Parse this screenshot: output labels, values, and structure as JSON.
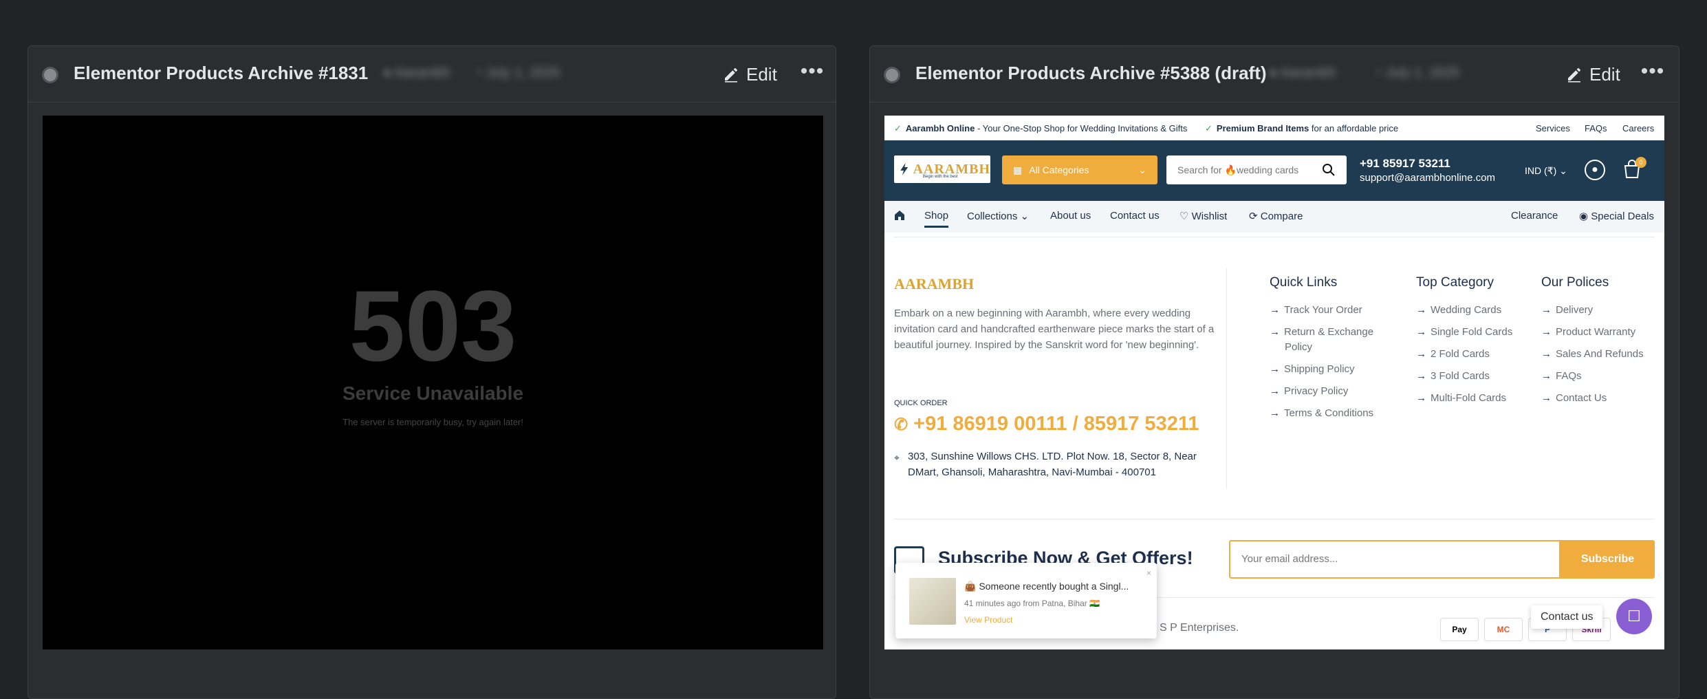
{
  "cards": [
    {
      "title": "Elementor Products Archive #1831",
      "meta_author": "Aarambh",
      "meta_date": "July 1, 2025",
      "edit_label": "Edit",
      "more_label": "•••",
      "error": {
        "code": "503",
        "title": "Service Unavailable",
        "message": "The server is temporarily busy, try again later!"
      }
    },
    {
      "title": "Elementor Products Archive #5388 (draft)",
      "meta_author": "Aarambh",
      "meta_date": "July 1, 2025",
      "edit_label": "Edit",
      "more_label": "•••"
    }
  ],
  "site": {
    "topbar": {
      "promo1_bold": "Aarambh Online",
      "promo1_rest": " - Your One-Stop Shop for Wedding Invitations & Gifts",
      "promo2_bold": "Premium Brand Items",
      "promo2_rest": " for an affordable price",
      "links": [
        "Services",
        "FAQs",
        "Careers"
      ]
    },
    "logo_text": "AARAMBH",
    "logo_sub": "Begin with the best",
    "categories_label": "All Categories",
    "search_placeholder": "Search for 🔥wedding cards",
    "header_phone": "+91 85917 53211",
    "header_email": "support@aarambhonline.com",
    "currency": "IND (₹)",
    "cart_count": "0",
    "nav": [
      "Shop",
      "Collections",
      "About us",
      "Contact us",
      "Wishlist",
      "Compare"
    ],
    "nav_right": [
      "Clearance",
      "Special Deals"
    ],
    "footer": {
      "about": "Embark on a new beginning with Aarambh, where every wedding invitation card and handcrafted earthenware piece marks the start of a beautiful journey. Inspired by the Sanskrit word for 'new beginning'.",
      "quick_order_label": "QUICK ORDER",
      "quick_order_phone": "+91 86919 00111 / 85917 53211",
      "address": "303, Sunshine Willows CHS. LTD. Plot Now. 18, Sector 8, Near DMart, Ghansoli, Maharashtra, Navi-Mumbai - 400701",
      "columns": [
        {
          "title": "Quick Links",
          "links": [
            "Track Your Order",
            "Return & Exchange",
            "Policy",
            "Shipping Policy",
            "Privacy Policy",
            "Terms & Conditions"
          ]
        },
        {
          "title": "Top Category",
          "links": [
            "Wedding Cards",
            "Single Fold Cards",
            "2 Fold Cards",
            "3 Fold Cards",
            "Multi-Fold Cards"
          ]
        },
        {
          "title": "Our Polices",
          "links": [
            "Delivery",
            "Product Warranty",
            "Sales And Refunds",
            "FAQs",
            "Contact Us"
          ]
        }
      ]
    },
    "subscribe": {
      "title": "Subscribe Now & Get Offers!",
      "placeholder": "Your email address...",
      "button": "Subscribe"
    },
    "copyright_tail": "S P Enterprises.",
    "payments": [
      "Pay",
      "MC",
      "P",
      "Skrill"
    ],
    "popup": {
      "line1": "👜 Someone recently bought a Singl...",
      "line2": "41 minutes ago from Patna, Bihar 🇮🇳",
      "link": "View Product",
      "close": "×"
    },
    "contact_chip": "Contact us"
  }
}
